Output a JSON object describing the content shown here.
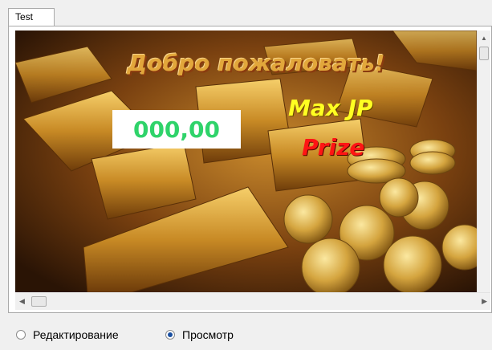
{
  "tabs": [
    {
      "label": "Test",
      "active": true
    }
  ],
  "banner": {
    "welcome_text": "Добро пожаловать!",
    "jackpot_value": "000,00",
    "jackpot_label": "Max JP",
    "prize_label": "Prize"
  },
  "scrollbars": {
    "vertical": {
      "up_arrow": "▲"
    },
    "horizontal": {
      "left_arrow": "◀",
      "right_arrow": "▶"
    }
  },
  "mode": {
    "options": [
      {
        "label": "Редактирование",
        "selected": false
      },
      {
        "label": "Просмотр",
        "selected": true
      }
    ]
  },
  "colors": {
    "welcome": "#e2a73b",
    "jackpot_value": "#2fd36a",
    "jackpot_label": "#ffff22",
    "prize_label": "#ff1414",
    "radio_selected": "#1a4fa0"
  }
}
